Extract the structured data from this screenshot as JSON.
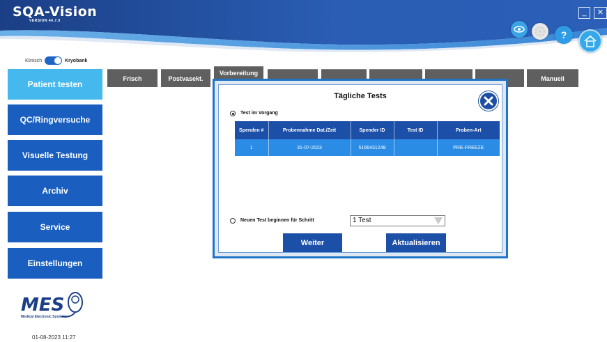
{
  "app": {
    "logo_text": "SQA-Vision",
    "version": "VERSION 44.7.0"
  },
  "header_buttons": {
    "minimize_label": "_",
    "close_label": "✕",
    "help_label": "?"
  },
  "mode_toggle": {
    "left_label": "Klinisch",
    "right_label": "Kryobank",
    "state": "Kryobank"
  },
  "sidebar": {
    "items": [
      {
        "label": "Patient testen",
        "active": true
      },
      {
        "label": "QC/Ringversuche",
        "active": false
      },
      {
        "label": "Visuelle Testung",
        "active": false
      },
      {
        "label": "Archiv",
        "active": false
      },
      {
        "label": "Service",
        "active": false
      },
      {
        "label": "Einstellungen",
        "active": false
      }
    ],
    "company_logo_text": "MES",
    "company_name": "Medical Electronic Systems",
    "datetime": "01-08-2023 11:27"
  },
  "tabs": [
    {
      "label": "Frisch"
    },
    {
      "label": "Postvasekt."
    },
    {
      "label": "Vorbereitung"
    },
    {
      "label": "Manuell"
    }
  ],
  "dialog": {
    "title": "Tägliche Tests",
    "option_in_progress": "Test im Vorgang",
    "option_new_test": "Neuen Test beginnen für Schritt",
    "selected_option": "Test im Vorgang",
    "table": {
      "headers": [
        "Spenden #",
        "Probennahme Dat./Zeit",
        "Spender ID",
        "Test ID",
        "Proben-Art"
      ],
      "rows": [
        [
          "1",
          "31-07-2023",
          "5166431248",
          "",
          "PRE-FREEZE"
        ]
      ]
    },
    "step_select_value": "1 Test",
    "next_button": "Weiter",
    "refresh_button": "Aktualisieren"
  },
  "colors": {
    "nav_blue": "#1a5fbf",
    "nav_active": "#45b8ee",
    "header_dark": "#1b3f86",
    "tab_gray": "#5f5f5f",
    "table_header": "#1c4fa8",
    "table_row": "#2b8ce6"
  },
  "icons": {
    "eye": "eye-icon",
    "gear": "gear-icon",
    "help": "help-icon",
    "home": "home-icon",
    "close": "close-icon",
    "dropdown": "chevron-down-icon"
  }
}
